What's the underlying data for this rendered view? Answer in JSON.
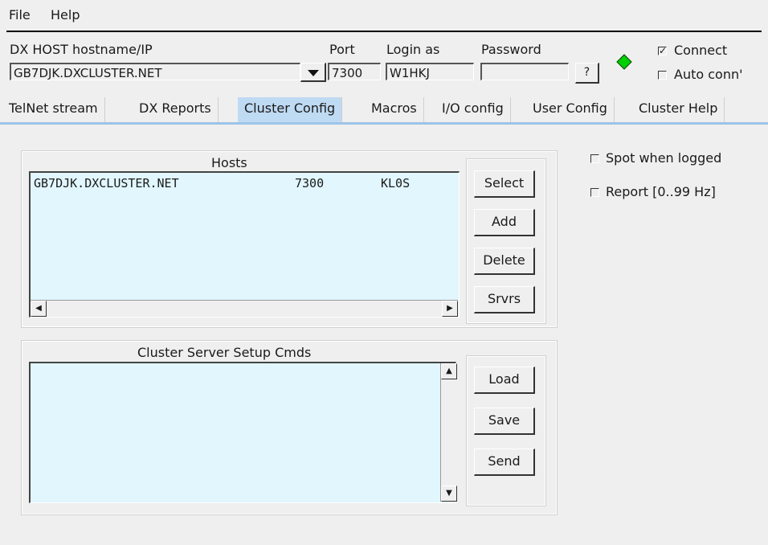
{
  "menu": {
    "file": "File",
    "help": "Help"
  },
  "connection": {
    "host_label": "DX HOST hostname/IP",
    "host_value": "GB7DJK.DXCLUSTER.NET",
    "port_label": "Port",
    "port_value": "7300",
    "login_label": "Login as",
    "login_value": "W1HKJ",
    "password_label": "Password",
    "password_value": "",
    "help_button": "?",
    "status_color": "#00d000",
    "connect_label": "Connect",
    "connect_checked": true,
    "autoconn_label": "Auto conn'",
    "autoconn_checked": false
  },
  "tabs": [
    {
      "label": "TelNet stream"
    },
    {
      "label": "DX Reports"
    },
    {
      "label": "Cluster Config",
      "active": true
    },
    {
      "label": "Macros"
    },
    {
      "label": "I/O config"
    },
    {
      "label": "User Config"
    },
    {
      "label": "Cluster Help"
    }
  ],
  "hosts": {
    "title": "Hosts",
    "rows": [
      {
        "host": "GB7DJK.DXCLUSTER.NET",
        "port": "7300",
        "login": "KL0S"
      }
    ],
    "buttons": {
      "select": "Select",
      "add": "Add",
      "delete": "Delete",
      "srvrs": "Srvrs"
    }
  },
  "setup": {
    "title": "Cluster Server Setup Cmds",
    "text": "",
    "buttons": {
      "load": "Load",
      "save": "Save",
      "send": "Send"
    }
  },
  "options": {
    "spot_when_logged": "Spot when logged",
    "report": "Report [0..99 Hz]"
  },
  "colors": {
    "list_bg": "#e1f6fd",
    "active_tab": "#bfdaf3",
    "accent_line": "#9cc4e8"
  }
}
